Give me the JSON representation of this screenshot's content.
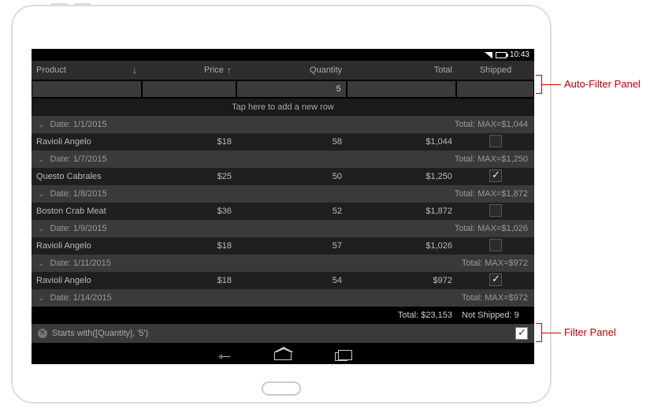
{
  "status": {
    "time": "10:43"
  },
  "columns": {
    "product": "Product",
    "price": "Price",
    "quantity": "Quantity",
    "total": "Total",
    "shipped": "Shipped"
  },
  "filter_row": {
    "product": "",
    "price": "",
    "quantity": "5",
    "total": "",
    "shipped": ""
  },
  "addnew_text": "Tap here to add a new row",
  "groups": [
    {
      "hdr_left": "Date: 1/1/2015",
      "hdr_right": "Total: MAX=$1,044",
      "rows": [
        {
          "product": "Ravioli Angelo",
          "price": "$18",
          "qty": "58",
          "total": "$1,044",
          "shipped": false
        }
      ]
    },
    {
      "hdr_left": "Date: 1/7/2015",
      "hdr_right": "Total: MAX=$1,250",
      "rows": [
        {
          "product": "Questo Cabrales",
          "price": "$25",
          "qty": "50",
          "total": "$1,250",
          "shipped": true
        }
      ]
    },
    {
      "hdr_left": "Date: 1/8/2015",
      "hdr_right": "Total: MAX=$1,872",
      "rows": [
        {
          "product": "Boston Crab Meat",
          "price": "$36",
          "qty": "52",
          "total": "$1,872",
          "shipped": false
        }
      ]
    },
    {
      "hdr_left": "Date: 1/9/2015",
      "hdr_right": "Total: MAX=$1,026",
      "rows": [
        {
          "product": "Ravioli Angelo",
          "price": "$18",
          "qty": "57",
          "total": "$1,026",
          "shipped": false
        }
      ]
    },
    {
      "hdr_left": "Date: 1/11/2015",
      "hdr_right": "Total: MAX=$972",
      "rows": [
        {
          "product": "Ravioli Angelo",
          "price": "$18",
          "qty": "54",
          "total": "$972",
          "shipped": true
        }
      ]
    },
    {
      "hdr_left": "Date: 1/14/2015",
      "hdr_right": "Total: MAX=$972",
      "rows": []
    }
  ],
  "summary": {
    "total": "Total: $23,153",
    "notshipped": "Not Shipped: 9"
  },
  "filter_panel": {
    "text": "Starts with([Quantity], '5')"
  },
  "callouts": {
    "autofilter": "Auto-Filter Panel",
    "filter": "Filter Panel"
  }
}
